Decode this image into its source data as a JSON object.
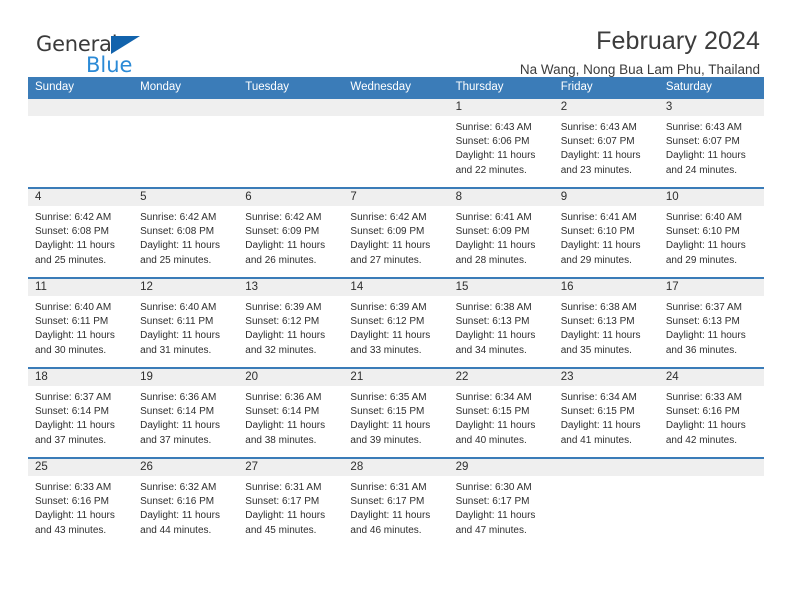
{
  "brand": {
    "name_top": "General",
    "name_bottom": "Blue",
    "triangle_color": "#1263ac",
    "blue_color": "#2b8ad6"
  },
  "header": {
    "title": "February 2024",
    "subtitle": "Na Wang, Nong Bua Lam Phu, Thailand"
  },
  "theme": {
    "header_row_bg": "#3b7cb8",
    "daynum_band_bg": "#efefef",
    "cell_bg": "#ffffff",
    "text_color": "#2e2e2e"
  },
  "weekday_headers": [
    "Sunday",
    "Monday",
    "Tuesday",
    "Wednesday",
    "Thursday",
    "Friday",
    "Saturday"
  ],
  "weeks": [
    [
      {
        "day": "",
        "sunrise": "",
        "sunset": "",
        "daylight_1": "",
        "daylight_2": ""
      },
      {
        "day": "",
        "sunrise": "",
        "sunset": "",
        "daylight_1": "",
        "daylight_2": ""
      },
      {
        "day": "",
        "sunrise": "",
        "sunset": "",
        "daylight_1": "",
        "daylight_2": ""
      },
      {
        "day": "",
        "sunrise": "",
        "sunset": "",
        "daylight_1": "",
        "daylight_2": ""
      },
      {
        "day": "1",
        "sunrise": "Sunrise: 6:43 AM",
        "sunset": "Sunset: 6:06 PM",
        "daylight_1": "Daylight: 11 hours",
        "daylight_2": "and 22 minutes."
      },
      {
        "day": "2",
        "sunrise": "Sunrise: 6:43 AM",
        "sunset": "Sunset: 6:07 PM",
        "daylight_1": "Daylight: 11 hours",
        "daylight_2": "and 23 minutes."
      },
      {
        "day": "3",
        "sunrise": "Sunrise: 6:43 AM",
        "sunset": "Sunset: 6:07 PM",
        "daylight_1": "Daylight: 11 hours",
        "daylight_2": "and 24 minutes."
      }
    ],
    [
      {
        "day": "4",
        "sunrise": "Sunrise: 6:42 AM",
        "sunset": "Sunset: 6:08 PM",
        "daylight_1": "Daylight: 11 hours",
        "daylight_2": "and 25 minutes."
      },
      {
        "day": "5",
        "sunrise": "Sunrise: 6:42 AM",
        "sunset": "Sunset: 6:08 PM",
        "daylight_1": "Daylight: 11 hours",
        "daylight_2": "and 25 minutes."
      },
      {
        "day": "6",
        "sunrise": "Sunrise: 6:42 AM",
        "sunset": "Sunset: 6:09 PM",
        "daylight_1": "Daylight: 11 hours",
        "daylight_2": "and 26 minutes."
      },
      {
        "day": "7",
        "sunrise": "Sunrise: 6:42 AM",
        "sunset": "Sunset: 6:09 PM",
        "daylight_1": "Daylight: 11 hours",
        "daylight_2": "and 27 minutes."
      },
      {
        "day": "8",
        "sunrise": "Sunrise: 6:41 AM",
        "sunset": "Sunset: 6:09 PM",
        "daylight_1": "Daylight: 11 hours",
        "daylight_2": "and 28 minutes."
      },
      {
        "day": "9",
        "sunrise": "Sunrise: 6:41 AM",
        "sunset": "Sunset: 6:10 PM",
        "daylight_1": "Daylight: 11 hours",
        "daylight_2": "and 29 minutes."
      },
      {
        "day": "10",
        "sunrise": "Sunrise: 6:40 AM",
        "sunset": "Sunset: 6:10 PM",
        "daylight_1": "Daylight: 11 hours",
        "daylight_2": "and 29 minutes."
      }
    ],
    [
      {
        "day": "11",
        "sunrise": "Sunrise: 6:40 AM",
        "sunset": "Sunset: 6:11 PM",
        "daylight_1": "Daylight: 11 hours",
        "daylight_2": "and 30 minutes."
      },
      {
        "day": "12",
        "sunrise": "Sunrise: 6:40 AM",
        "sunset": "Sunset: 6:11 PM",
        "daylight_1": "Daylight: 11 hours",
        "daylight_2": "and 31 minutes."
      },
      {
        "day": "13",
        "sunrise": "Sunrise: 6:39 AM",
        "sunset": "Sunset: 6:12 PM",
        "daylight_1": "Daylight: 11 hours",
        "daylight_2": "and 32 minutes."
      },
      {
        "day": "14",
        "sunrise": "Sunrise: 6:39 AM",
        "sunset": "Sunset: 6:12 PM",
        "daylight_1": "Daylight: 11 hours",
        "daylight_2": "and 33 minutes."
      },
      {
        "day": "15",
        "sunrise": "Sunrise: 6:38 AM",
        "sunset": "Sunset: 6:13 PM",
        "daylight_1": "Daylight: 11 hours",
        "daylight_2": "and 34 minutes."
      },
      {
        "day": "16",
        "sunrise": "Sunrise: 6:38 AM",
        "sunset": "Sunset: 6:13 PM",
        "daylight_1": "Daylight: 11 hours",
        "daylight_2": "and 35 minutes."
      },
      {
        "day": "17",
        "sunrise": "Sunrise: 6:37 AM",
        "sunset": "Sunset: 6:13 PM",
        "daylight_1": "Daylight: 11 hours",
        "daylight_2": "and 36 minutes."
      }
    ],
    [
      {
        "day": "18",
        "sunrise": "Sunrise: 6:37 AM",
        "sunset": "Sunset: 6:14 PM",
        "daylight_1": "Daylight: 11 hours",
        "daylight_2": "and 37 minutes."
      },
      {
        "day": "19",
        "sunrise": "Sunrise: 6:36 AM",
        "sunset": "Sunset: 6:14 PM",
        "daylight_1": "Daylight: 11 hours",
        "daylight_2": "and 37 minutes."
      },
      {
        "day": "20",
        "sunrise": "Sunrise: 6:36 AM",
        "sunset": "Sunset: 6:14 PM",
        "daylight_1": "Daylight: 11 hours",
        "daylight_2": "and 38 minutes."
      },
      {
        "day": "21",
        "sunrise": "Sunrise: 6:35 AM",
        "sunset": "Sunset: 6:15 PM",
        "daylight_1": "Daylight: 11 hours",
        "daylight_2": "and 39 minutes."
      },
      {
        "day": "22",
        "sunrise": "Sunrise: 6:34 AM",
        "sunset": "Sunset: 6:15 PM",
        "daylight_1": "Daylight: 11 hours",
        "daylight_2": "and 40 minutes."
      },
      {
        "day": "23",
        "sunrise": "Sunrise: 6:34 AM",
        "sunset": "Sunset: 6:15 PM",
        "daylight_1": "Daylight: 11 hours",
        "daylight_2": "and 41 minutes."
      },
      {
        "day": "24",
        "sunrise": "Sunrise: 6:33 AM",
        "sunset": "Sunset: 6:16 PM",
        "daylight_1": "Daylight: 11 hours",
        "daylight_2": "and 42 minutes."
      }
    ],
    [
      {
        "day": "25",
        "sunrise": "Sunrise: 6:33 AM",
        "sunset": "Sunset: 6:16 PM",
        "daylight_1": "Daylight: 11 hours",
        "daylight_2": "and 43 minutes."
      },
      {
        "day": "26",
        "sunrise": "Sunrise: 6:32 AM",
        "sunset": "Sunset: 6:16 PM",
        "daylight_1": "Daylight: 11 hours",
        "daylight_2": "and 44 minutes."
      },
      {
        "day": "27",
        "sunrise": "Sunrise: 6:31 AM",
        "sunset": "Sunset: 6:17 PM",
        "daylight_1": "Daylight: 11 hours",
        "daylight_2": "and 45 minutes."
      },
      {
        "day": "28",
        "sunrise": "Sunrise: 6:31 AM",
        "sunset": "Sunset: 6:17 PM",
        "daylight_1": "Daylight: 11 hours",
        "daylight_2": "and 46 minutes."
      },
      {
        "day": "29",
        "sunrise": "Sunrise: 6:30 AM",
        "sunset": "Sunset: 6:17 PM",
        "daylight_1": "Daylight: 11 hours",
        "daylight_2": "and 47 minutes."
      },
      {
        "day": "",
        "sunrise": "",
        "sunset": "",
        "daylight_1": "",
        "daylight_2": ""
      },
      {
        "day": "",
        "sunrise": "",
        "sunset": "",
        "daylight_1": "",
        "daylight_2": ""
      }
    ]
  ]
}
